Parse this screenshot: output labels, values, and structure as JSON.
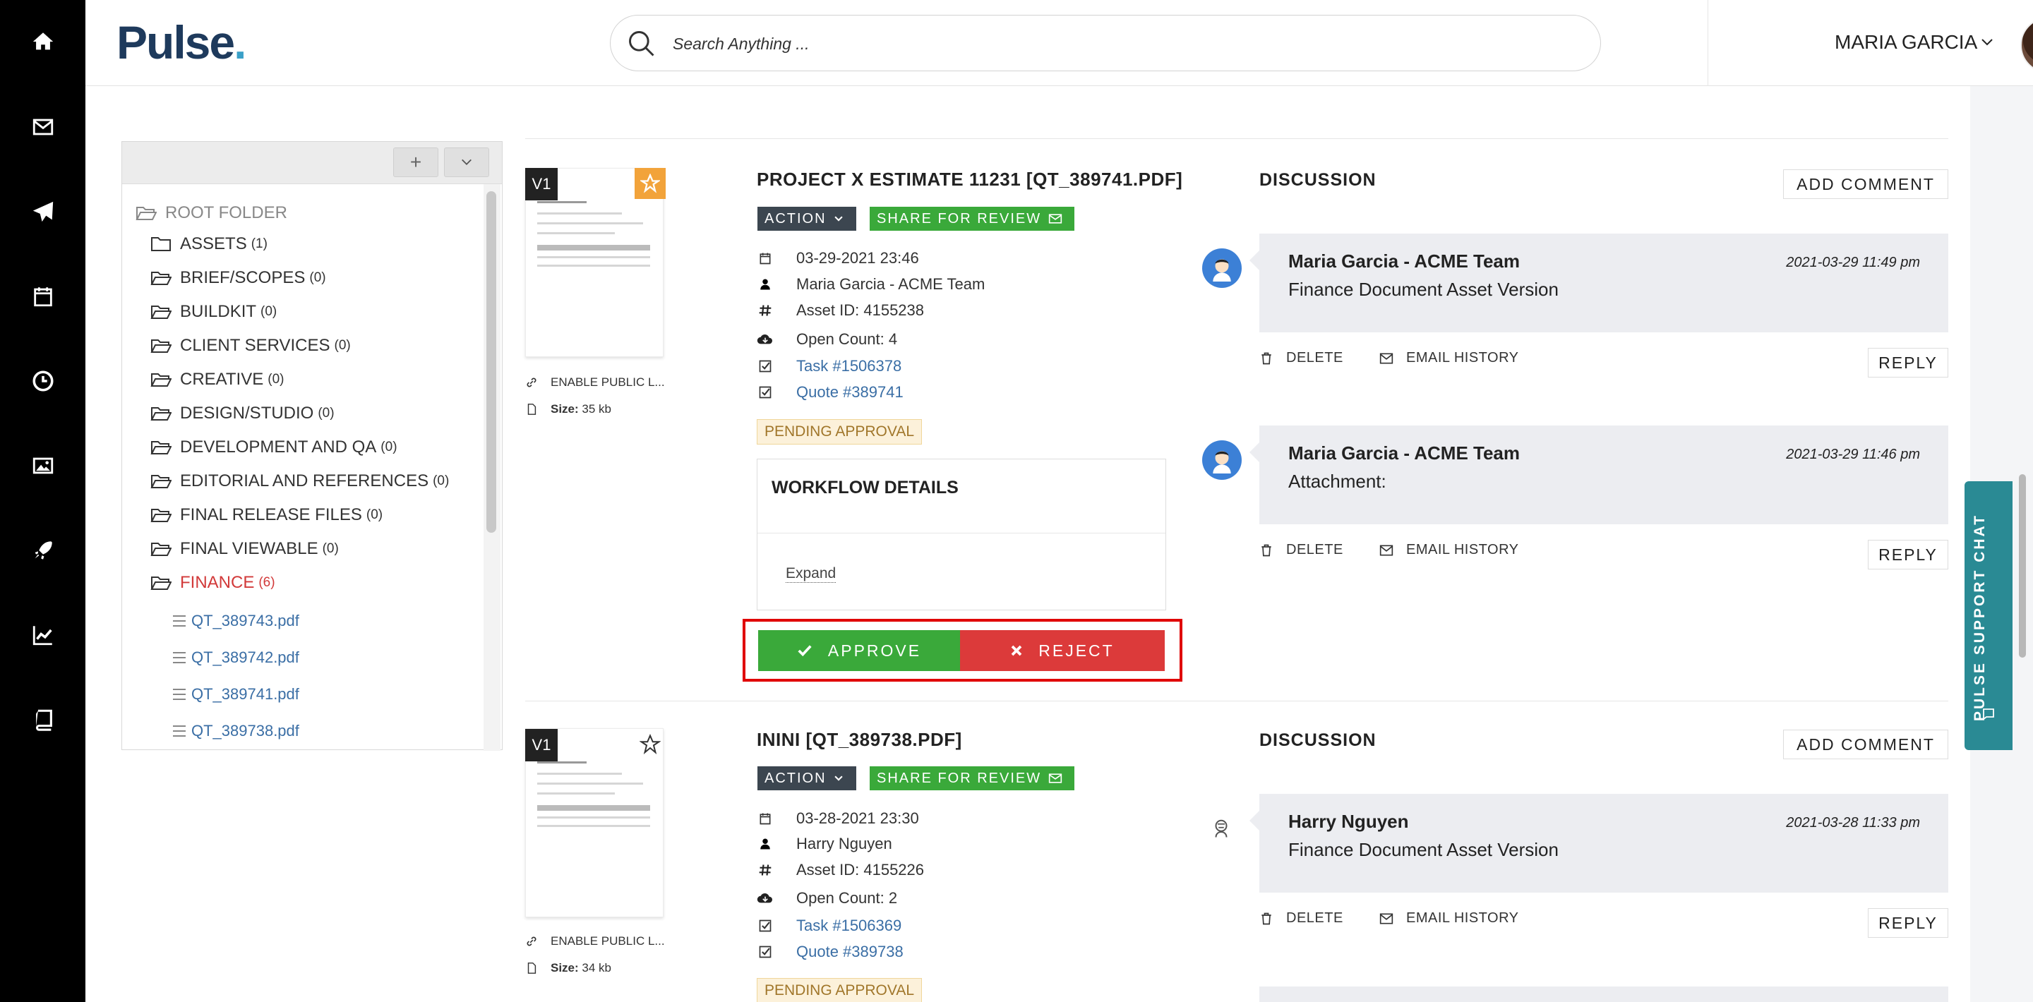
{
  "sidebar": {
    "icons": [
      "home-icon",
      "mail-icon",
      "send-icon",
      "calendar-icon",
      "clock-icon",
      "image-icon",
      "rocket-icon",
      "chart-icon",
      "book-icon"
    ]
  },
  "header": {
    "logo": "Pulse",
    "logo_dot": ".",
    "search_placeholder": "Search Anything ...",
    "user_name": "MARIA GARCIA"
  },
  "tree": {
    "add_label": "+",
    "root": "ROOT FOLDER",
    "folders": [
      {
        "name": "ASSETS",
        "count": "(1)"
      },
      {
        "name": "BRIEF/SCOPES",
        "count": "(0)"
      },
      {
        "name": "BUILDKIT",
        "count": "(0)"
      },
      {
        "name": "CLIENT SERVICES",
        "count": "(0)"
      },
      {
        "name": "CREATIVE",
        "count": "(0)"
      },
      {
        "name": "DESIGN/STUDIO",
        "count": "(0)"
      },
      {
        "name": "DEVELOPMENT AND QA",
        "count": "(0)"
      },
      {
        "name": "EDITORIAL AND REFERENCES",
        "count": "(0)"
      },
      {
        "name": "FINAL RELEASE FILES",
        "count": "(0)"
      },
      {
        "name": "FINAL VIEWABLE",
        "count": "(0)"
      },
      {
        "name": "FINANCE",
        "count": "(6)"
      }
    ],
    "files": [
      "QT_389743.pdf",
      "QT_389742.pdf",
      "QT_389741.pdf",
      "QT_389738.pdf"
    ]
  },
  "assets": [
    {
      "version": "V1",
      "title": "PROJECT X ESTIMATE 11231 [QT_389741.PDF]",
      "action_label": "ACTION",
      "share_label": "SHARE FOR REVIEW",
      "date": "03-29-2021 23:46",
      "owner": "Maria Garcia - ACME Team",
      "asset_id": "Asset ID: 4155238",
      "open_count": "Open Count: 4",
      "task": "Task #1506378",
      "quote": "Quote #389741",
      "status": "PENDING APPROVAL",
      "public_link": "ENABLE PUBLIC L...",
      "size_label": "Size:",
      "size_value": "35 kb",
      "workflow_title": "WORKFLOW DETAILS",
      "workflow_expand": "Expand",
      "approve_label": "APPROVE",
      "reject_label": "REJECT",
      "discussion_title": "DISCUSSION",
      "add_comment": "ADD COMMENT",
      "comments": [
        {
          "author": "Maria Garcia - ACME Team",
          "date": "2021-03-29 11:49 pm",
          "text": "Finance Document Asset Version",
          "delete": "DELETE",
          "email_history": "EMAIL HISTORY",
          "reply": "REPLY"
        },
        {
          "author": "Maria Garcia - ACME Team",
          "date": "2021-03-29 11:46 pm",
          "text": "Attachment:",
          "delete": "DELETE",
          "email_history": "EMAIL HISTORY",
          "reply": "REPLY"
        }
      ]
    },
    {
      "version": "V1",
      "title": "ININI [QT_389738.PDF]",
      "action_label": "ACTION",
      "share_label": "SHARE FOR REVIEW",
      "date": "03-28-2021 23:30",
      "owner": "Harry Nguyen",
      "asset_id": "Asset ID: 4155226",
      "open_count": "Open Count: 2",
      "task": "Task #1506369",
      "quote": "Quote #389738",
      "status": "PENDING APPROVAL",
      "public_link": "ENABLE PUBLIC L...",
      "size_label": "Size:",
      "size_value": "34 kb",
      "discussion_title": "DISCUSSION",
      "add_comment": "ADD COMMENT",
      "comments": [
        {
          "author": "Harry Nguyen",
          "date": "2021-03-28 11:33 pm",
          "text": "Finance Document Asset Version",
          "delete": "DELETE",
          "email_history": "EMAIL HISTORY",
          "reply": "REPLY"
        }
      ]
    }
  ],
  "support_chat": "PULSE SUPPORT CHAT",
  "colors": {
    "sidebar": "#000000",
    "approve": "#3aa93a",
    "reject": "#dc3a3a",
    "active_folder": "#d23a3a",
    "link": "#3a6ea5",
    "support": "#2a8a94"
  }
}
